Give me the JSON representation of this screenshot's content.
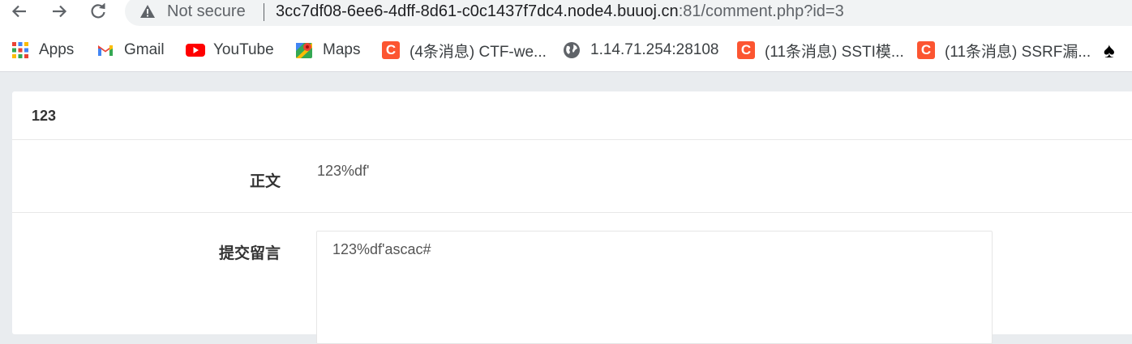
{
  "browser": {
    "security_label": "Not secure",
    "url_host": "3cc7df08-6ee6-4dff-8d61-c0c1437f7dc4.node4.buuoj.cn",
    "url_rest": ":81/comment.php?id=3"
  },
  "bookmarks": [
    {
      "label": "Apps",
      "icon": "apps-grid-icon"
    },
    {
      "label": "Gmail",
      "icon": "gmail-icon"
    },
    {
      "label": "YouTube",
      "icon": "youtube-icon"
    },
    {
      "label": "Maps",
      "icon": "maps-icon"
    },
    {
      "label": "(4条消息) CTF-we...",
      "icon": "csdn-icon"
    },
    {
      "label": "1.14.71.254:28108",
      "icon": "globe-icon"
    },
    {
      "label": "(11条消息) SSTI模...",
      "icon": "csdn-icon"
    },
    {
      "label": "(11条消息) SSRF漏...",
      "icon": "csdn-icon"
    },
    {
      "label": "",
      "icon": "spade-icon"
    }
  ],
  "icon_glyphs": {
    "csdn": "C",
    "spade": "♠"
  },
  "colors": {
    "csdn": "#fc5531",
    "youtube": "#ff0000",
    "page_background": "#e9ecef"
  },
  "page": {
    "title": "123",
    "body_label": "正文",
    "body_value": "123%df'",
    "comment_label": "提交留言",
    "comment_value": "123%df'ascac#"
  }
}
